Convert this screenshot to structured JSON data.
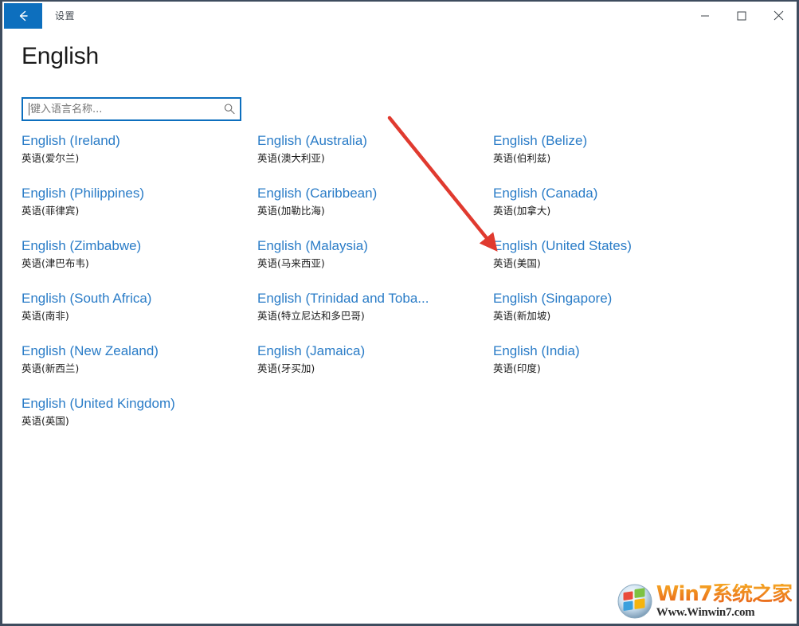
{
  "window": {
    "app_title": "设置",
    "back_icon": "arrow-left-icon",
    "controls": {
      "minimize": "minimize-icon",
      "maximize": "maximize-icon",
      "close": "close-icon"
    },
    "accent_color": "#0d6fbe",
    "border_color": "#3e4c5e"
  },
  "page": {
    "title": "English"
  },
  "search": {
    "value": "",
    "placeholder": "键入语言名称...",
    "icon": "search-icon"
  },
  "languages": {
    "link_color": "#2a7cc7",
    "columns": [
      [
        {
          "native": "English (Ireland)",
          "local": "英语(爱尔兰)"
        },
        {
          "native": "English (Philippines)",
          "local": "英语(菲律宾)"
        },
        {
          "native": "English (Zimbabwe)",
          "local": "英语(津巴布韦)"
        },
        {
          "native": "English (South Africa)",
          "local": "英语(南非)"
        },
        {
          "native": "English (New Zealand)",
          "local": "英语(新西兰)"
        },
        {
          "native": "English (United Kingdom)",
          "local": "英语(英国)"
        }
      ],
      [
        {
          "native": "English (Australia)",
          "local": "英语(澳大利亚)"
        },
        {
          "native": "English (Caribbean)",
          "local": "英语(加勒比海)"
        },
        {
          "native": "English (Malaysia)",
          "local": "英语(马来西亚)"
        },
        {
          "native": "English (Trinidad and Toba...",
          "local": "英语(特立尼达和多巴哥)"
        },
        {
          "native": "English (Jamaica)",
          "local": "英语(牙买加)"
        }
      ],
      [
        {
          "native": "English (Belize)",
          "local": "英语(伯利兹)"
        },
        {
          "native": "English (Canada)",
          "local": "英语(加拿大)"
        },
        {
          "native": "English (United States)",
          "local": "英语(美国)"
        },
        {
          "native": "English (Singapore)",
          "local": "英语(新加坡)"
        },
        {
          "native": "English (India)",
          "local": "英语(印度)"
        }
      ]
    ]
  },
  "annotation": {
    "type": "arrow",
    "color": "#e03a2f",
    "points_to": "English (United States)"
  },
  "watermark": {
    "title": "Win7系统之家",
    "url": "Www.Winwin7.com",
    "logo": "windows-logo-icon"
  }
}
